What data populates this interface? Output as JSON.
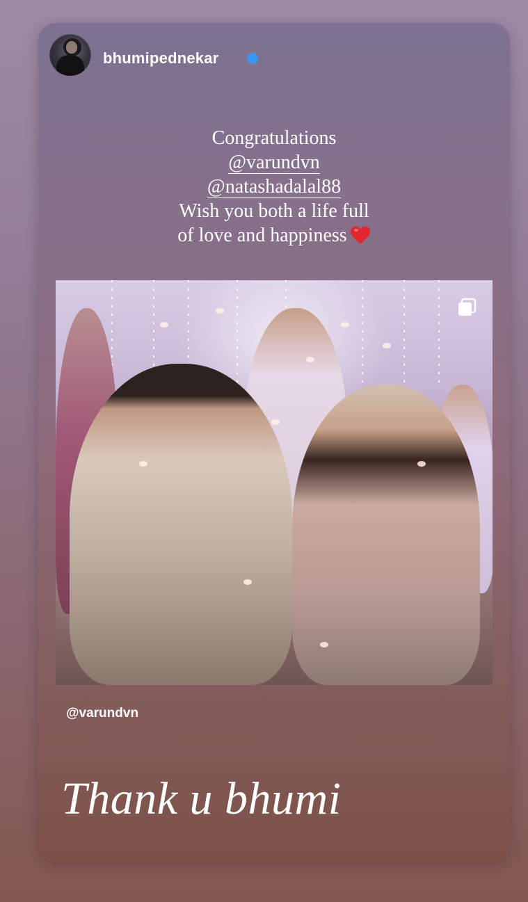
{
  "story": {
    "username": "bhumipednekar",
    "verified": true,
    "caption": {
      "line1": "Congratulations",
      "mention1": "@varundvn",
      "mention2": "@natashadalal88",
      "line4": "Wish you both a life full",
      "line5": "of love and happiness",
      "emoji": "heart-emoji"
    },
    "shared_post": {
      "credit": "@varundvn",
      "multi_image_icon": "carousel-icon"
    },
    "reply_text": "Thank u bhumi"
  },
  "colors": {
    "verified_badge": "#3897f0",
    "heart": "#e2252f",
    "text": "#ffffff"
  }
}
